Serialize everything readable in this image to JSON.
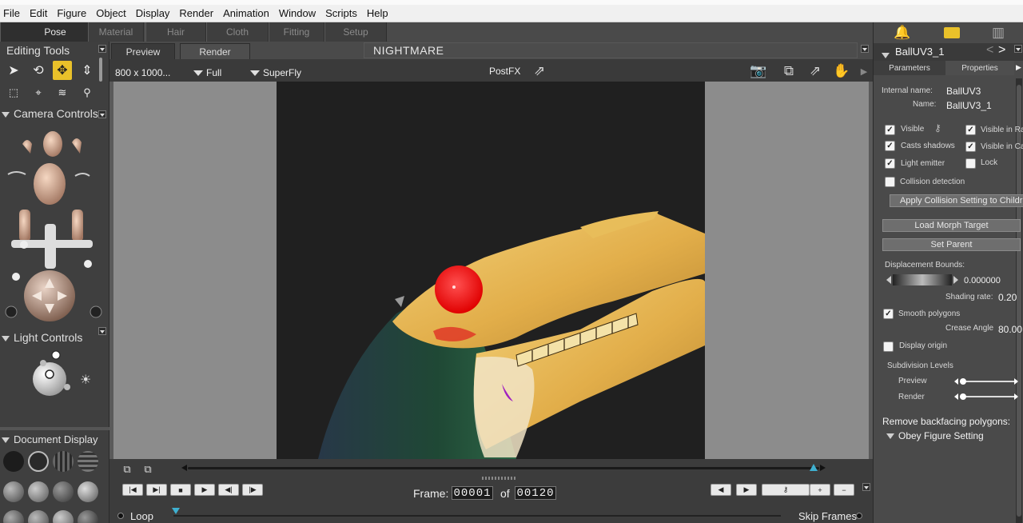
{
  "menu": [
    "File",
    "Edit",
    "Figure",
    "Object",
    "Display",
    "Render",
    "Animation",
    "Window",
    "Scripts",
    "Help"
  ],
  "room_tabs": [
    "Pose",
    "Material",
    "Hair",
    "Cloth",
    "Fitting",
    "Setup"
  ],
  "active_room": "Pose",
  "left": {
    "editing_tools": "Editing Tools",
    "camera_controls": "Camera Controls",
    "light_controls": "Light Controls",
    "document_display": "Document  Display"
  },
  "viewport": {
    "tabs": [
      "Preview",
      "Render"
    ],
    "title": "NIGHTMARE",
    "resolution": "800 x 1000...",
    "quality": "Full",
    "engine": "SuperFly",
    "postfx": "PostFX"
  },
  "timeline": {
    "frame_label": "Frame:",
    "current_frame": "00001",
    "of_label": "of",
    "total_frames": "00120",
    "loop_label": "Loop",
    "skip_frames_label": "Skip Frames"
  },
  "right": {
    "object_name": "BallUV3_1",
    "tabs": [
      "Parameters",
      "Properties"
    ],
    "internal_name_label": "Internal name:",
    "internal_name": "BallUV3",
    "name_label": "Name:",
    "name": "BallUV3_1",
    "visible": "Visible",
    "visible_in_ra": "Visible in Ra",
    "casts_shadows": "Casts shadows",
    "visible_in_ca": "Visible in Ca",
    "light_emitter": "Light emitter",
    "lock": "Lock",
    "collision_detection": "Collision detection",
    "apply_collision": "Apply Collision Setting to Childre",
    "load_morph": "Load Morph Target",
    "set_parent": "Set Parent",
    "displacement_bounds": "Displacement Bounds:",
    "displacement_value": "0.000000",
    "shading_rate_label": "Shading rate:",
    "shading_rate": "0.20",
    "smooth_polygons": "Smooth polygons",
    "crease_angle_label": "Crease Angle",
    "crease_angle": "80.00",
    "display_origin": "Display origin",
    "subdivision_levels": "Subdivision Levels",
    "preview_label": "Preview",
    "render_label": "Render",
    "remove_backfacing": "Remove backfacing polygons:",
    "obey_figure": "Obey Figure Setting"
  },
  "colors": {
    "accent": "#e9c12a",
    "skull": "#e6b450",
    "eye": "#ff1a1a",
    "render_bg": "#202020"
  }
}
